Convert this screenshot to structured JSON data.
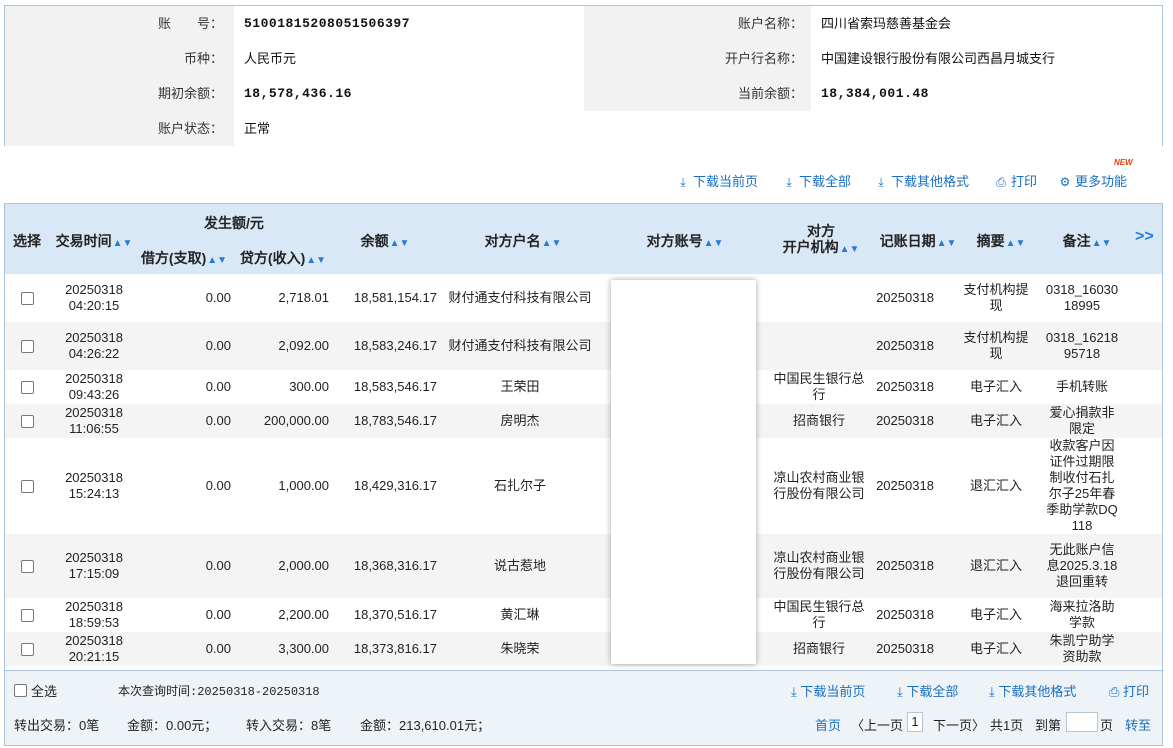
{
  "account": {
    "account_no_label": "账　　号：",
    "account_no": "51001815208051506397",
    "account_name_label": "账户名称：",
    "account_name": "四川省索玛慈善基金会",
    "currency_label": "币种：",
    "currency": "人民币元",
    "bank_label": "开户行名称：",
    "bank": "中国建设银行股份有限公司西昌月城支行",
    "opening_balance_label": "期初余额：",
    "opening_balance": "18,578,436.16",
    "current_balance_label": "当前余额：",
    "current_balance": "18,384,001.48",
    "status_label": "账户状态：",
    "status": "正常"
  },
  "toolbar": {
    "download_page": "下载当前页",
    "download_all": "下载全部",
    "download_other": "下载其他格式",
    "print": "打印",
    "more": "更多功能",
    "new_badge": "NEW"
  },
  "table": {
    "headers": {
      "select": "选择",
      "time": "交易时间",
      "amount_group": "发生额/元",
      "debit": "借方(支取)",
      "credit": "贷方(收入)",
      "balance": "余额",
      "counterparty_name": "对方户名",
      "counterparty_account": "对方账号",
      "counterparty_bank_1": "对方",
      "counterparty_bank_2": "开户机构",
      "posting_date": "记账日期",
      "summary": "摘要",
      "remark": "备注",
      "expand": ">>"
    },
    "rows": [
      {
        "date": "20250318",
        "time": "04:20:15",
        "debit": "0.00",
        "credit": "2,718.01",
        "balance": "18,581,154.17",
        "name": "财付通支付科技有限公司",
        "bank": "",
        "post": "20250318",
        "summary": "支付机构提现",
        "remark": "0318_1603018995"
      },
      {
        "date": "20250318",
        "time": "04:26:22",
        "debit": "0.00",
        "credit": "2,092.00",
        "balance": "18,583,246.17",
        "name": "财付通支付科技有限公司",
        "bank": "",
        "post": "20250318",
        "summary": "支付机构提现",
        "remark": "0318_1621895718"
      },
      {
        "date": "20250318",
        "time": "09:43:26",
        "debit": "0.00",
        "credit": "300.00",
        "balance": "18,583,546.17",
        "name": "王荣田",
        "bank": "中国民生银行总行",
        "post": "20250318",
        "summary": "电子汇入",
        "remark": "手机转账"
      },
      {
        "date": "20250318",
        "time": "11:06:55",
        "debit": "0.00",
        "credit": "200,000.00",
        "balance": "18,783,546.17",
        "name": "房明杰",
        "bank": "招商银行",
        "post": "20250318",
        "summary": "电子汇入",
        "remark": "爱心捐款非限定"
      },
      {
        "date": "20250318",
        "time": "15:24:13",
        "debit": "0.00",
        "credit": "1,000.00",
        "balance": "18,429,316.17",
        "name": "石扎尔子",
        "bank": "凉山农村商业银行股份有限公司",
        "post": "20250318",
        "summary": "退汇汇入",
        "remark": "收款客户因证件过期限制收付石扎尔子25年春季助学款DQ118"
      },
      {
        "date": "20250318",
        "time": "17:15:09",
        "debit": "0.00",
        "credit": "2,000.00",
        "balance": "18,368,316.17",
        "name": "说古惹地",
        "bank": "凉山农村商业银行股份有限公司",
        "post": "20250318",
        "summary": "退汇汇入",
        "remark": "无此账户信息2025.3.18退回重转"
      },
      {
        "date": "20250318",
        "time": "18:59:53",
        "debit": "0.00",
        "credit": "2,200.00",
        "balance": "18,370,516.17",
        "name": "黄汇琳",
        "bank": "中国民生银行总行",
        "post": "20250318",
        "summary": "电子汇入",
        "remark": "海来拉洛助学款"
      },
      {
        "date": "20250318",
        "time": "20:21:15",
        "debit": "0.00",
        "credit": "3,300.00",
        "balance": "18,373,816.17",
        "name": "朱晓荣",
        "bank": "招商银行",
        "post": "20250318",
        "summary": "电子汇入",
        "remark": "朱凯宁助学资助款"
      }
    ]
  },
  "footer": {
    "select_all": "全选",
    "query_time": "本次查询时间:20250318-20250318",
    "download_page": "下载当前页",
    "download_all": "下载全部",
    "download_other": "下载其他格式",
    "print": "打印",
    "out_count": "转出交易：0笔",
    "out_amount": "金额：0.00元；",
    "in_count": "转入交易：8笔",
    "in_amount": "金额：213,610.01元；",
    "first": "首页",
    "prev": "〈上一页",
    "page": "1",
    "next": "下一页〉",
    "total": "共1页",
    "goto": "到第",
    "page_unit": "页",
    "go": "转至"
  }
}
